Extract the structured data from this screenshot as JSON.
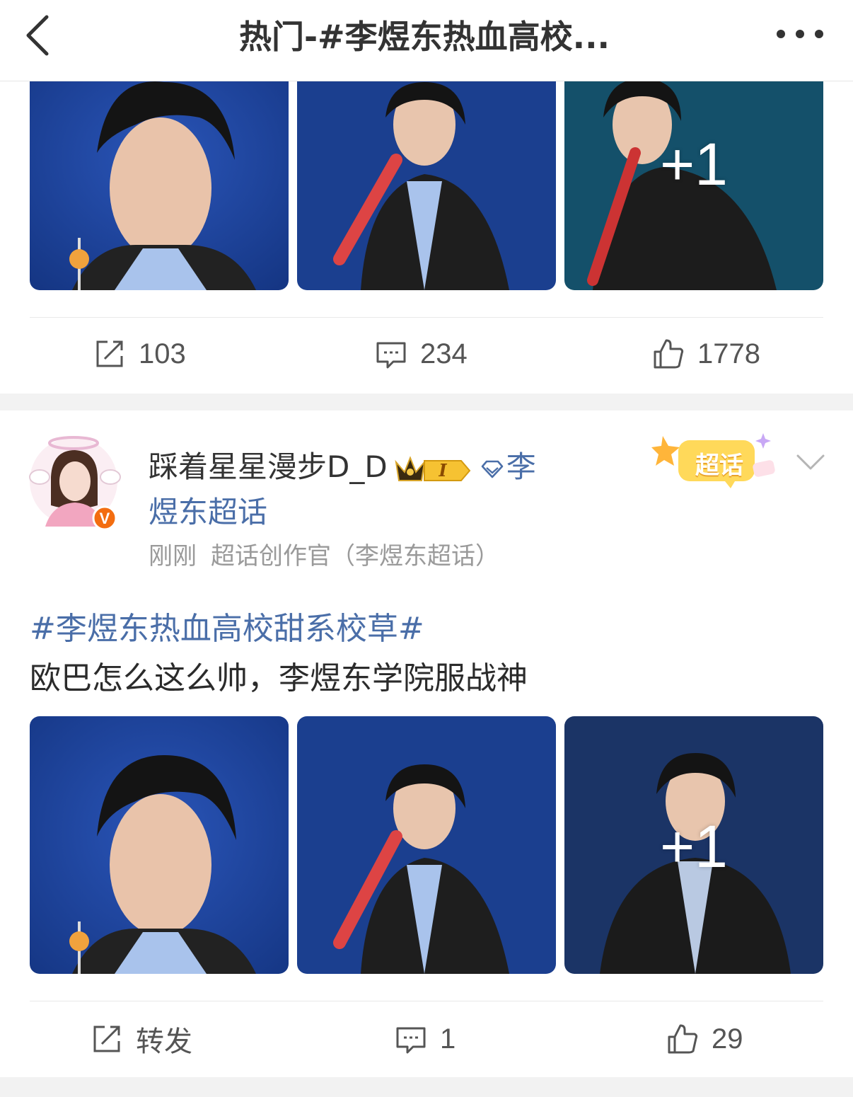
{
  "header": {
    "title": "热门-#李煜东热血高校..."
  },
  "post1": {
    "images": [
      {
        "desc": "portrait-with-lollipop"
      },
      {
        "desc": "holding-bat"
      },
      {
        "desc": "teal-background"
      }
    ],
    "more_images": "+1",
    "actions": {
      "repost": "103",
      "comment": "234",
      "like": "1778"
    }
  },
  "post2": {
    "username": "踩着星星漫步D_D",
    "topic_part1": "李",
    "topic_part2": "煜东超话",
    "time": "刚刚",
    "source": "超话创作官（李煜东超话）",
    "sticker_label": "超话",
    "hashtag": "#李煜东热血高校甜系校草#",
    "text": "欧巴怎么这么帅，李煜东学院服战神",
    "more_images": "+1",
    "actions": {
      "repost": "转发",
      "comment": "1",
      "like": "29"
    }
  },
  "colors": {
    "link": "#4a6ea8",
    "image_blue": "#1b3f8f",
    "image_teal": "#14506a",
    "separator": "#f2f2f2"
  }
}
